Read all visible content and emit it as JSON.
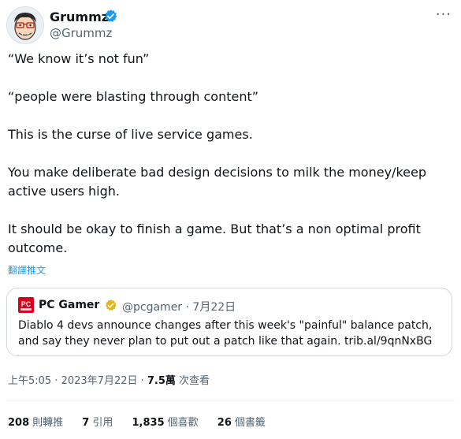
{
  "author": {
    "display_name": "Grummz",
    "handle": "@Grummz"
  },
  "tweet": {
    "paragraphs": [
      "“We know it’s not fun”",
      "“people were blasting through content”",
      "This is the curse of live service games.",
      "You make deliberate bad design decisions to milk the money/keep active users high.",
      "It should be okay to finish a game. But that’s a non optimal profit outcome."
    ],
    "translate_label": "翻譯推文",
    "more_label": "···"
  },
  "quote": {
    "name": "PC Gamer",
    "meta": "@pcgamer · 7月22日",
    "text": "Diablo 4 devs announce changes after this week's \"painful\" balance patch, and say they never plan to put out a patch like that again. trib.al/9qnNxBG",
    "logo_text": "PC"
  },
  "timestamp": {
    "time": "上午5:05 · 2023年7月22日 · ",
    "views_count": "7.5萬",
    "views_label": " 次查看"
  },
  "stats": [
    {
      "count": "208",
      "label": "則轉推"
    },
    {
      "count": "7",
      "label": "引用"
    },
    {
      "count": "1,835",
      "label": "個喜歡"
    },
    {
      "count": "26",
      "label": "個書籤"
    }
  ],
  "colors": {
    "accent": "#1d9bf0",
    "gold_verified": "#e2b719",
    "pcgamer_red": "#d4001c"
  },
  "icons": {
    "verified": "verified-badge-icon",
    "gold_verified": "gold-verified-badge-icon",
    "more": "more-options-icon"
  }
}
